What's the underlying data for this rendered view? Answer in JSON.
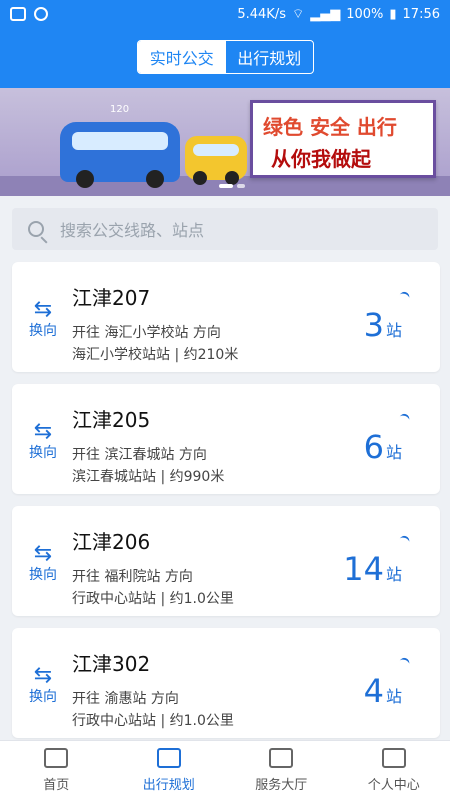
{
  "status_bar": {
    "speed": "5.44K/s",
    "battery": "100%",
    "time": "17:56"
  },
  "header": {
    "tabs": [
      {
        "label": "实时公交"
      },
      {
        "label": "出行规划"
      }
    ]
  },
  "banner": {
    "slogan_line1": "绿色 安全 出行",
    "slogan_line2": "从你我做起",
    "bus_number": "120"
  },
  "search": {
    "placeholder": "搜索公交线路、站点"
  },
  "routes": [
    {
      "swap_label": "换向",
      "name": "江津207",
      "direction": "开往 海汇小学校站 方向",
      "station": "海汇小学校站站 | 约210米",
      "stops": "3",
      "stops_unit": "站"
    },
    {
      "swap_label": "换向",
      "name": "江津205",
      "direction": "开往 滨江春城站 方向",
      "station": "滨江春城站站 | 约990米",
      "stops": "6",
      "stops_unit": "站"
    },
    {
      "swap_label": "换向",
      "name": "江津206",
      "direction": "开往 福利院站 方向",
      "station": "行政中心站站 | 约1.0公里",
      "stops": "14",
      "stops_unit": "站"
    },
    {
      "swap_label": "换向",
      "name": "江津302",
      "direction": "开往 渝惠站 方向",
      "station": "行政中心站站 | 约1.0公里",
      "stops": "4",
      "stops_unit": "站"
    }
  ],
  "tabbar": {
    "items": [
      {
        "label": "首页"
      },
      {
        "label": "出行规划"
      },
      {
        "label": "服务大厅"
      },
      {
        "label": "个人中心"
      }
    ]
  },
  "colors": {
    "primary": "#1f86f3",
    "accent": "#1e6fd6"
  }
}
